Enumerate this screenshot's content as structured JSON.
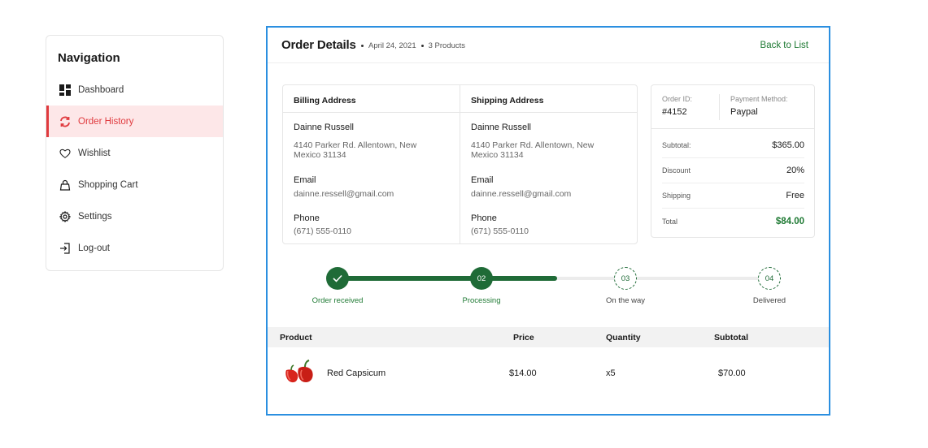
{
  "sidebar": {
    "title": "Navigation",
    "items": [
      {
        "label": "Dashboard",
        "icon": "dashboard-icon",
        "active": false
      },
      {
        "label": "Order History",
        "icon": "refresh-icon",
        "active": true
      },
      {
        "label": "Wishlist",
        "icon": "heart-icon",
        "active": false
      },
      {
        "label": "Shopping Cart",
        "icon": "bag-icon",
        "active": false
      },
      {
        "label": "Settings",
        "icon": "gear-icon",
        "active": false
      },
      {
        "label": "Log-out",
        "icon": "logout-icon",
        "active": false
      }
    ]
  },
  "header": {
    "title": "Order Details",
    "date": "April 24, 2021",
    "products": "3 Products",
    "back_label": "Back to List"
  },
  "billing": {
    "heading": "Billing Address",
    "name": "Dainne Russell",
    "address": "4140 Parker Rd. Allentown, New Mexico 31134",
    "email_label": "Email",
    "email": "dainne.ressell@gmail.com",
    "phone_label": "Phone",
    "phone": "(671) 555-0110"
  },
  "shipping": {
    "heading": "Shipping Address",
    "name": "Dainne Russell",
    "address": "4140 Parker Rd. Allentown, New Mexico 31134",
    "email_label": "Email",
    "email": "dainne.ressell@gmail.com",
    "phone_label": "Phone",
    "phone": "(671) 555-0110"
  },
  "summary": {
    "order_id_label": "Order ID:",
    "order_id": "#4152",
    "payment_label": "Payment Method:",
    "payment": "Paypal",
    "subtotal_label": "Subtotal:",
    "subtotal": "$365.00",
    "discount_label": "Discount",
    "discount": "20%",
    "shipping_label": "Shipping",
    "shipping": "Free",
    "total_label": "Total",
    "total": "$84.00"
  },
  "progress": {
    "steps": [
      {
        "label": "Order received",
        "marker": "",
        "status": "done"
      },
      {
        "label": "Processing",
        "marker": "02",
        "status": "current"
      },
      {
        "label": "On the way",
        "marker": "03",
        "status": "pending"
      },
      {
        "label": "Delivered",
        "marker": "04",
        "status": "pending"
      }
    ],
    "completed_fraction": 0.5
  },
  "table": {
    "headers": {
      "product": "Product",
      "price": "Price",
      "quantity": "Quantity",
      "subtotal": "Subtotal"
    },
    "rows": [
      {
        "product": "Red Capsicum",
        "price": "$14.00",
        "quantity": "x5",
        "subtotal": "$70.00"
      }
    ]
  },
  "colors": {
    "accent_green": "#1f6b37",
    "active_red": "#e03a3e",
    "selection_blue": "#2b8fe0"
  }
}
